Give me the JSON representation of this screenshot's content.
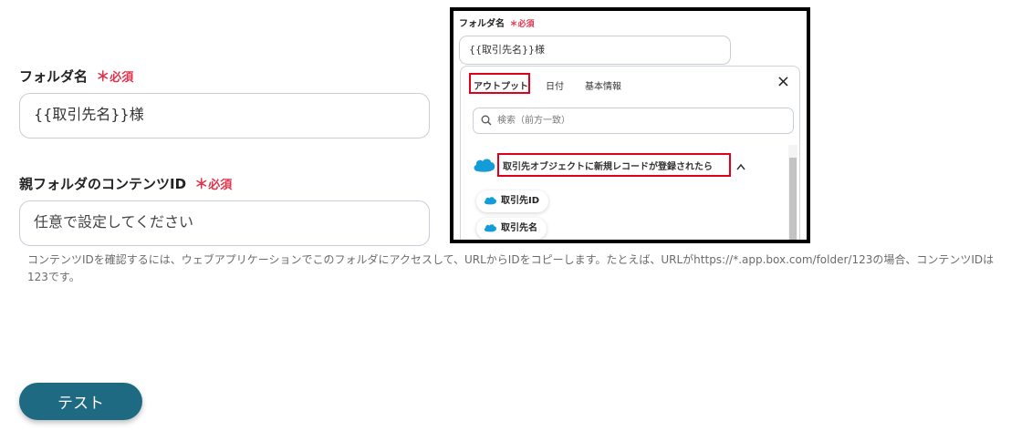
{
  "form": {
    "folder_name": {
      "label": "フォルダ名",
      "required": "必須",
      "value": "{{取引先名}}様"
    },
    "parent_folder_id": {
      "label": "親フォルダのコンテンツID",
      "required": "必須",
      "placeholder": "任意で設定してください"
    },
    "help_text": "コンテンツIDを確認するには、ウェブアプリケーションでこのフォルダにアクセスして、URLからIDをコピーします。たとえば、URLがhttps://*.app.box.com/folder/123の場合、コンテンツIDは123です。",
    "test_button": "テスト",
    "required_color": "#e0344c",
    "button_color": "#1e6a82"
  },
  "screenshot": {
    "field_label": "フォルダ名",
    "required": "必須",
    "field_value": "{{取引先名}}様",
    "tabs": [
      "アウトプット",
      "日付",
      "基本情報"
    ],
    "close": "×",
    "search_placeholder": "検索（前方一致）",
    "section_title": "取引先オブジェクトに新規レコードが登録されたら",
    "items": [
      "取引先ID",
      "取引先名"
    ],
    "highlight_color": "#e0001b",
    "icons": [
      "close-icon",
      "search-icon",
      "salesforce-cloud-icon",
      "chevron-up-icon"
    ]
  }
}
